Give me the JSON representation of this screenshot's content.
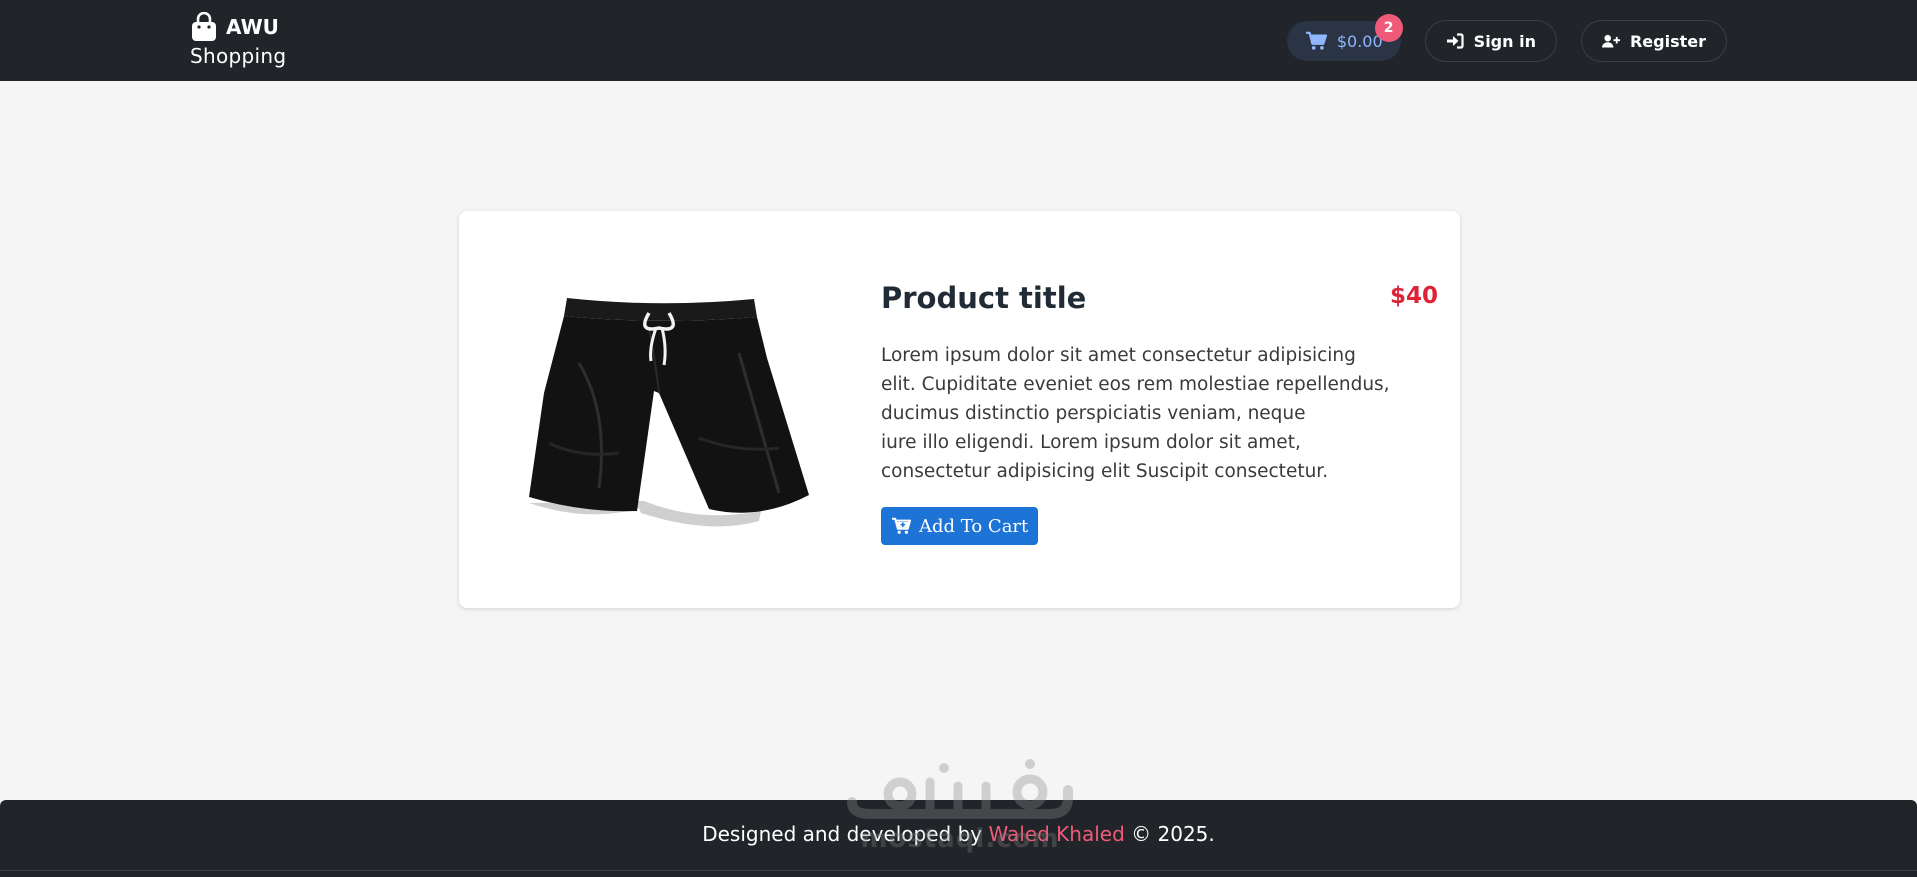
{
  "navbar": {
    "brand_name": "AWU",
    "brand_sub": "Shopping",
    "cart_total": "$0.00",
    "cart_count": "2",
    "sign_in_label": "Sign in",
    "register_label": "Register"
  },
  "product": {
    "title": "Product title",
    "price": "$40",
    "description_lines": [
      "Lorem ipsum dolor sit amet consectetur adipisicing",
      "elit. Cupiditate eveniet eos rem molestiae repellendus,",
      "ducimus distinctio perspiciatis veniam, neque",
      "iure illo eligendi. Lorem ipsum dolor sit amet,",
      "consectetur adipisicing elit Suscipit consectetur."
    ],
    "add_to_cart_label": "Add To Cart",
    "image_icon": "black-shorts-image"
  },
  "footer": {
    "prefix": "Designed and developed by ",
    "author": "Waled Khaled",
    "suffix": " © 2025."
  },
  "watermark": {
    "text": "mostaql.com"
  },
  "colors": {
    "navbar_bg": "#212529",
    "price": "#dc2438",
    "button": "#1d74d6",
    "badge": "#ef5a79",
    "link": "#ef5a79"
  },
  "icons": {
    "brand": "shopping-bag-icon",
    "cart": "cart-icon",
    "sign_in": "sign-in-icon",
    "register": "user-plus-icon",
    "add_to_cart": "cart-plus-icon"
  }
}
